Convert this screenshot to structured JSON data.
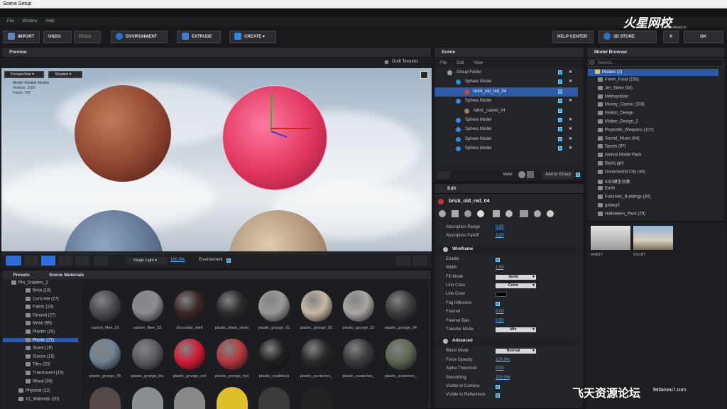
{
  "window": {
    "title": "Scene Setup"
  },
  "menu": [
    "File",
    "Window",
    "Help"
  ],
  "toolbar": {
    "import": "IMPORT",
    "undo": "UNDO",
    "redo": "REDO",
    "environment": "ENVIRONMENT",
    "extrude": "EXTRUDE",
    "create": "CREATE",
    "help_center": "HELP CENTER",
    "store": "3D STORE",
    "close": "X",
    "ok": "OK"
  },
  "preview": {
    "title": "Preview",
    "draft": "Draft Textures",
    "camera": "Perspective",
    "shading": "Shaded",
    "stats": [
      "Model: Multiple Models",
      "Vertices: 3160",
      "Faces: 720"
    ],
    "light": "Single Light",
    "zoom": "100.0%",
    "environment": "Environment"
  },
  "scene": {
    "title": "Scene",
    "menu": [
      "File",
      "Edit",
      "View"
    ],
    "items": [
      {
        "label": "Group Folder",
        "indent": 0
      },
      {
        "label": "Sphere Model",
        "indent": 1
      },
      {
        "label": "brick_old_red_04",
        "indent": 2,
        "selected": true
      },
      {
        "label": "Sphere Model",
        "indent": 1
      },
      {
        "label": "fabric_carpet_04",
        "indent": 2
      },
      {
        "label": "Sphere Model",
        "indent": 1
      },
      {
        "label": "Sphere Model",
        "indent": 1
      },
      {
        "label": "Sphere Model",
        "indent": 1
      },
      {
        "label": "Sphere Model",
        "indent": 1
      }
    ],
    "view_label": "View:",
    "add_group": "Add to Group"
  },
  "edit": {
    "title": "Edit",
    "material": "brick_old_red_04",
    "top_props": [
      {
        "k": "Absorption Range",
        "v": "0.00"
      },
      {
        "k": "Absorption Falloff",
        "v": "2.00"
      }
    ],
    "wire_title": "Wireframe",
    "wire_props": [
      {
        "k": "Enable",
        "t": "chk"
      },
      {
        "k": "Width",
        "v": "1.00"
      },
      {
        "k": "Fill Mode",
        "d": "Solid"
      },
      {
        "k": "Line Color",
        "d": "Color"
      },
      {
        "k": "Line Color",
        "t": "swatch"
      },
      {
        "k": "Fog Influence",
        "t": "chk"
      },
      {
        "k": "Fresnel",
        "v": "0.00"
      },
      {
        "k": "Fresnel Bias",
        "v": "0.50"
      },
      {
        "k": "Transfer Mode",
        "d": "Mix"
      }
    ],
    "adv_title": "Advanced",
    "adv_props": [
      {
        "k": "Blend Mode",
        "d": "Normal"
      },
      {
        "k": "Force Opacity",
        "v": "100.0%"
      },
      {
        "k": "Alpha Threshold",
        "v": "0.00"
      },
      {
        "k": "Smoothing",
        "v": "100.0%"
      },
      {
        "k": "Visible to Camera",
        "t": "chk"
      },
      {
        "k": "Visible to Reflections",
        "t": "chk"
      }
    ]
  },
  "model_browser": {
    "title": "Model Browser",
    "search_placeholder": "Search...",
    "root": "Models (2)",
    "folders": [
      "Fresh_Food (158)",
      "Jet_Strike (54)",
      "Metropolitan",
      "Money_Casino (108)",
      "Motion_Design",
      "Motion_Design_2",
      "Projectile_Weapons (107)",
      "Sound_Music (84)",
      "Sports (87)",
      "Animal Model Pack",
      "BackLight",
      "Dreamworld City (40)",
      "E3D模型收集",
      "Earth",
      "Futuristic_Buildings (60)",
      "galaxy3",
      "Halloween_Pack (29)"
    ],
    "thumbs": [
      "RMB1Y",
      "WE1BT"
    ]
  },
  "presets": {
    "tab1": "Presets",
    "tab2": "Scene Materials",
    "root": "Pro_Shaders_2",
    "folders": [
      "Brick (16)",
      "Concrete (27)",
      "Fabric (19)",
      "Ground (27)",
      "Metal (69)",
      "Plaster (20)",
      "Plastic (21)",
      "Stone (19)",
      "Stucco (19)",
      "Tiles (20)",
      "Translucent (15)",
      "Wood (38)"
    ],
    "extra": [
      "Physical (22)",
      "V1_Materials (20)"
    ],
    "materials": [
      {
        "n": "carbon_fiber_01",
        "c": "#4a4c50"
      },
      {
        "n": "carbon_fiber_02",
        "c": "#8a8c90"
      },
      {
        "n": "chocolate_dark",
        "c": "#3a2826"
      },
      {
        "n": "plastic_black_clean",
        "c": "#2a2b2d"
      },
      {
        "n": "plastic_grunge_01",
        "c": "#9a9a9a"
      },
      {
        "n": "plastic_grunge_02",
        "c": "#c8b8a4"
      },
      {
        "n": "plastic_grunge_03",
        "c": "#a9a6a2"
      },
      {
        "n": "plastic_grunge_04",
        "c": "#3c3d3f"
      },
      {
        "n": "plastic_grunge_05",
        "c": "#6f8392"
      },
      {
        "n": "plastic_grunge_blu",
        "c": "#5a5c5f"
      },
      {
        "n": "plastic_grunge_red",
        "c": "#d41d35"
      },
      {
        "n": "plastic_grunge_red",
        "c": "#b5393f"
      },
      {
        "n": "plastic_roadblock",
        "c": "#1f1f20"
      },
      {
        "n": "plastic_scratches_",
        "c": "#2a2a2c"
      },
      {
        "n": "plastic_scratches_",
        "c": "#3a3b3d"
      },
      {
        "n": "plastic_scratches_",
        "c": "#5e6853"
      }
    ]
  },
  "watermark": {
    "top": "火星网校",
    "top_url": "www.vhxsd.cn",
    "bottom": "飞天资源论坛",
    "bottom_url": "feitianwu7.com"
  }
}
